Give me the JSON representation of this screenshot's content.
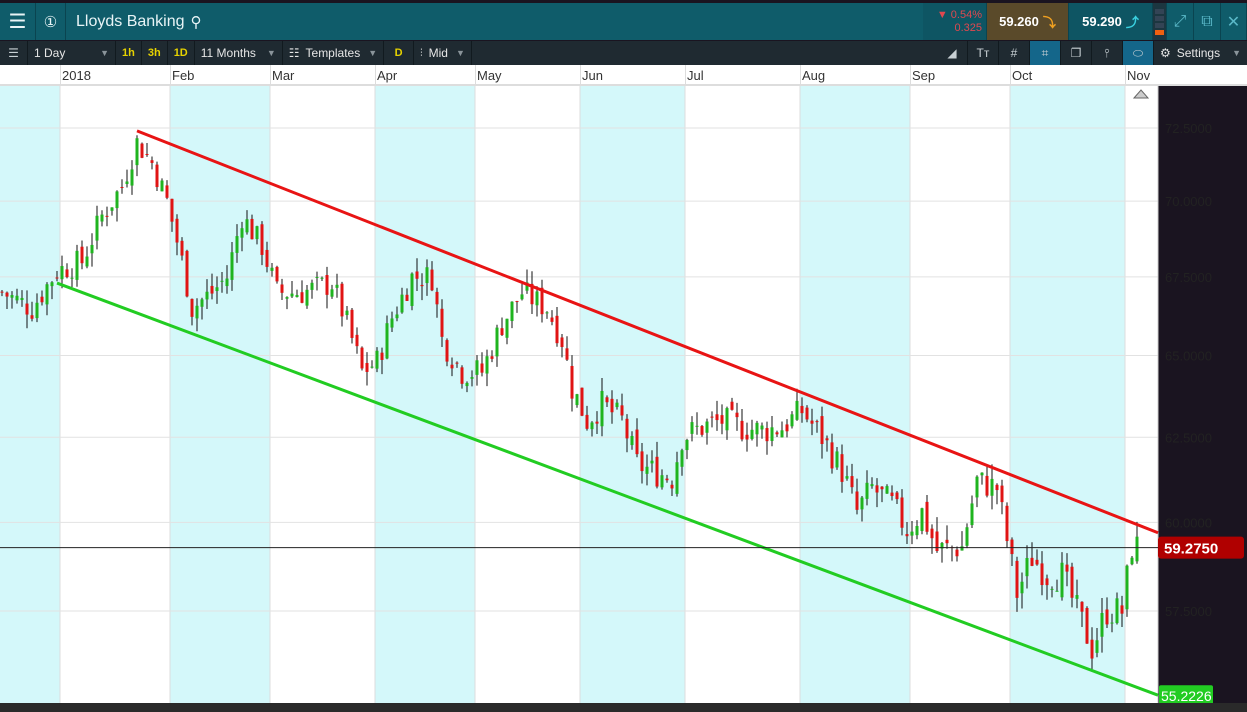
{
  "header": {
    "title": "Lloyds Banking",
    "change_pct": "0.54%",
    "change_abs": "0.325",
    "sell": "59.260",
    "buy": "59.290",
    "settings": "Settings"
  },
  "toolbar": {
    "interval": "1 Day",
    "q1": "1h",
    "q2": "3h",
    "q3": "1D",
    "range": "11 Months",
    "templates": "Templates",
    "d": "D",
    "price_type": "Mid"
  },
  "colors": {
    "up": "#1fb41f",
    "down": "#e01414",
    "resistance": "#e81414",
    "support": "#22cc22",
    "band": "#d4f8fa"
  },
  "chart_data": {
    "type": "candlestick",
    "title": "Lloyds Banking",
    "x_months": [
      "2018",
      "Feb",
      "Mar",
      "Apr",
      "May",
      "Jun",
      "Jul",
      "Aug",
      "Sep",
      "Oct",
      "Nov"
    ],
    "month_start_day": [
      12,
      34,
      54,
      75,
      95,
      116,
      137,
      160,
      182,
      202,
      225
    ],
    "y_ticks": [
      72.5,
      70,
      67.5,
      65,
      62.5,
      60,
      57.5
    ],
    "y_tick_labels": [
      "72.5000",
      "70.0000",
      "67.5000",
      "65.0000",
      "62.5000",
      "60.0000",
      "57.5000"
    ],
    "ylim": [
      54.6,
      74.0
    ],
    "close_keypoints_day_price": [
      [
        0,
        67.0
      ],
      [
        6,
        66.5
      ],
      [
        11,
        67.7
      ],
      [
        16,
        68.0
      ],
      [
        20,
        69.5
      ],
      [
        24,
        70.5
      ],
      [
        27,
        72.0
      ],
      [
        30,
        71.3
      ],
      [
        33,
        70
      ],
      [
        36,
        68
      ],
      [
        38,
        66.5
      ],
      [
        42,
        67
      ],
      [
        45,
        67.5
      ],
      [
        48,
        69.5
      ],
      [
        52,
        68.5
      ],
      [
        55,
        67
      ],
      [
        60,
        67
      ],
      [
        66,
        67.3
      ],
      [
        69,
        66
      ],
      [
        72,
        64.5
      ],
      [
        75,
        64.8
      ],
      [
        78,
        66.2
      ],
      [
        82,
        67.5
      ],
      [
        86,
        67.5
      ],
      [
        88,
        65.5
      ],
      [
        92,
        64.5
      ],
      [
        96,
        64.5
      ],
      [
        100,
        66
      ],
      [
        104,
        67
      ],
      [
        109,
        66.5
      ],
      [
        112,
        65.5
      ],
      [
        114,
        64
      ],
      [
        117,
        63
      ],
      [
        120,
        63.5
      ],
      [
        124,
        63
      ],
      [
        127,
        61.7
      ],
      [
        130,
        61.5
      ],
      [
        134,
        61.3
      ],
      [
        136,
        62.5
      ],
      [
        140,
        62.8
      ],
      [
        144,
        63
      ],
      [
        148,
        62.8
      ],
      [
        152,
        62.7
      ],
      [
        156,
        62.8
      ],
      [
        160,
        63.3
      ],
      [
        164,
        62.5
      ],
      [
        168,
        61.5
      ],
      [
        171,
        60.3
      ],
      [
        174,
        61
      ],
      [
        178,
        60.5
      ],
      [
        181,
        59.8
      ],
      [
        184,
        60.3
      ],
      [
        187,
        59.2
      ],
      [
        192,
        59.3
      ],
      [
        195,
        61.2
      ],
      [
        199,
        61
      ],
      [
        201,
        59.5
      ],
      [
        203,
        58
      ],
      [
        206,
        59
      ],
      [
        209,
        58.5
      ],
      [
        212,
        58.5
      ],
      [
        215,
        57.5
      ],
      [
        218,
        56.5
      ],
      [
        221,
        57.5
      ],
      [
        224,
        57.5
      ],
      [
        226,
        59.3
      ],
      [
        227,
        59.3
      ]
    ],
    "resistance_line": {
      "from": [
        27,
        72.4
      ],
      "to": [
        231,
        59.7
      ]
    },
    "support_line": {
      "from": [
        11,
        67.3
      ],
      "to": [
        231,
        55.2226
      ]
    },
    "last_price": 59.275,
    "last_price_label": "59.2750",
    "support_label": "55.2226"
  }
}
